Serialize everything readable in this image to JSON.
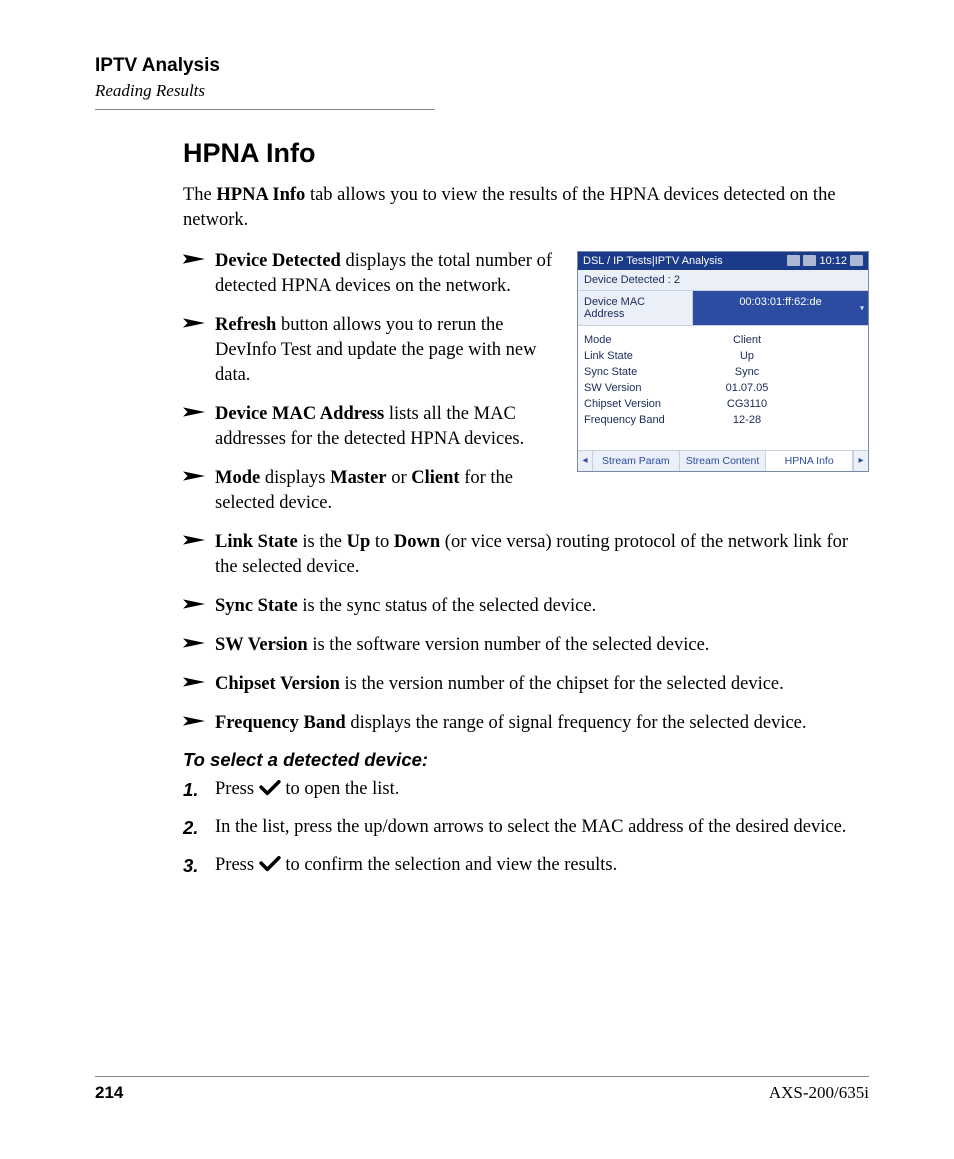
{
  "header": {
    "title": "IPTV Analysis",
    "subtitle": "Reading Results"
  },
  "section": {
    "title": "HPNA Info",
    "intro_pre": "The ",
    "intro_bold": "HPNA Info",
    "intro_post": " tab allows you to view the results of the HPNA devices detected on the network."
  },
  "bullets": [
    {
      "bold": "Device Detected",
      "text": " displays the total number of detected HPNA devices on the network."
    },
    {
      "bold": "Refresh",
      "text": " button allows you to rerun the DevInfo Test and update the page with new data."
    },
    {
      "bold": "Device MAC Address",
      "text": " lists all the MAC addresses for the detected HPNA devices."
    },
    {
      "bold": "Mode",
      "text_pre": " displays ",
      "b2": "Master",
      "mid": " or ",
      "b3": "Client",
      "text_post": " for the selected device."
    },
    {
      "bold": "Link State",
      "text_pre": " is the ",
      "b2": "Up",
      "mid": " to ",
      "b3": "Down",
      "text_post": " (or vice versa) routing protocol of the network link for the selected device."
    },
    {
      "bold": "Sync State",
      "text": " is the sync status of the selected device."
    },
    {
      "bold": "SW Version",
      "text": " is the software version number of the selected device."
    },
    {
      "bold": "Chipset Version",
      "text": " is the version number of the chipset for the selected device."
    },
    {
      "bold": "Frequency Band",
      "text": " displays the range of signal frequency for the selected device."
    }
  ],
  "instructions": {
    "heading": "To select a detected device:",
    "steps": [
      {
        "n": "1.",
        "pre": "Press ",
        "post": " to open the list."
      },
      {
        "n": "2.",
        "pre": "In the list, press the up/down arrows to select the MAC address of the desired device.",
        "post": ""
      },
      {
        "n": "3.",
        "pre": "Press ",
        "post": " to confirm the selection and view the results."
      }
    ]
  },
  "screenshot": {
    "title": "DSL / IP Tests|IPTV Analysis",
    "clock": "10:12",
    "detected_label": "Device Detected : 2",
    "mac_label": "Device MAC Address",
    "mac_value": "00:03:01:ff:62:de",
    "rows": [
      {
        "label": "Mode",
        "value": "Client"
      },
      {
        "label": "Link State",
        "value": "Up"
      },
      {
        "label": "Sync State",
        "value": "Sync"
      },
      {
        "label": "SW Version",
        "value": "01.07.05"
      },
      {
        "label": "Chipset Version",
        "value": "CG3110"
      },
      {
        "label": "Frequency Band",
        "value": "12-28"
      }
    ],
    "tabs": [
      {
        "label": "Stream Param",
        "active": false
      },
      {
        "label": "Stream Content",
        "active": false
      },
      {
        "label": "HPNA Info",
        "active": true
      }
    ]
  },
  "footer": {
    "page": "214",
    "model": "AXS-200/635i"
  }
}
